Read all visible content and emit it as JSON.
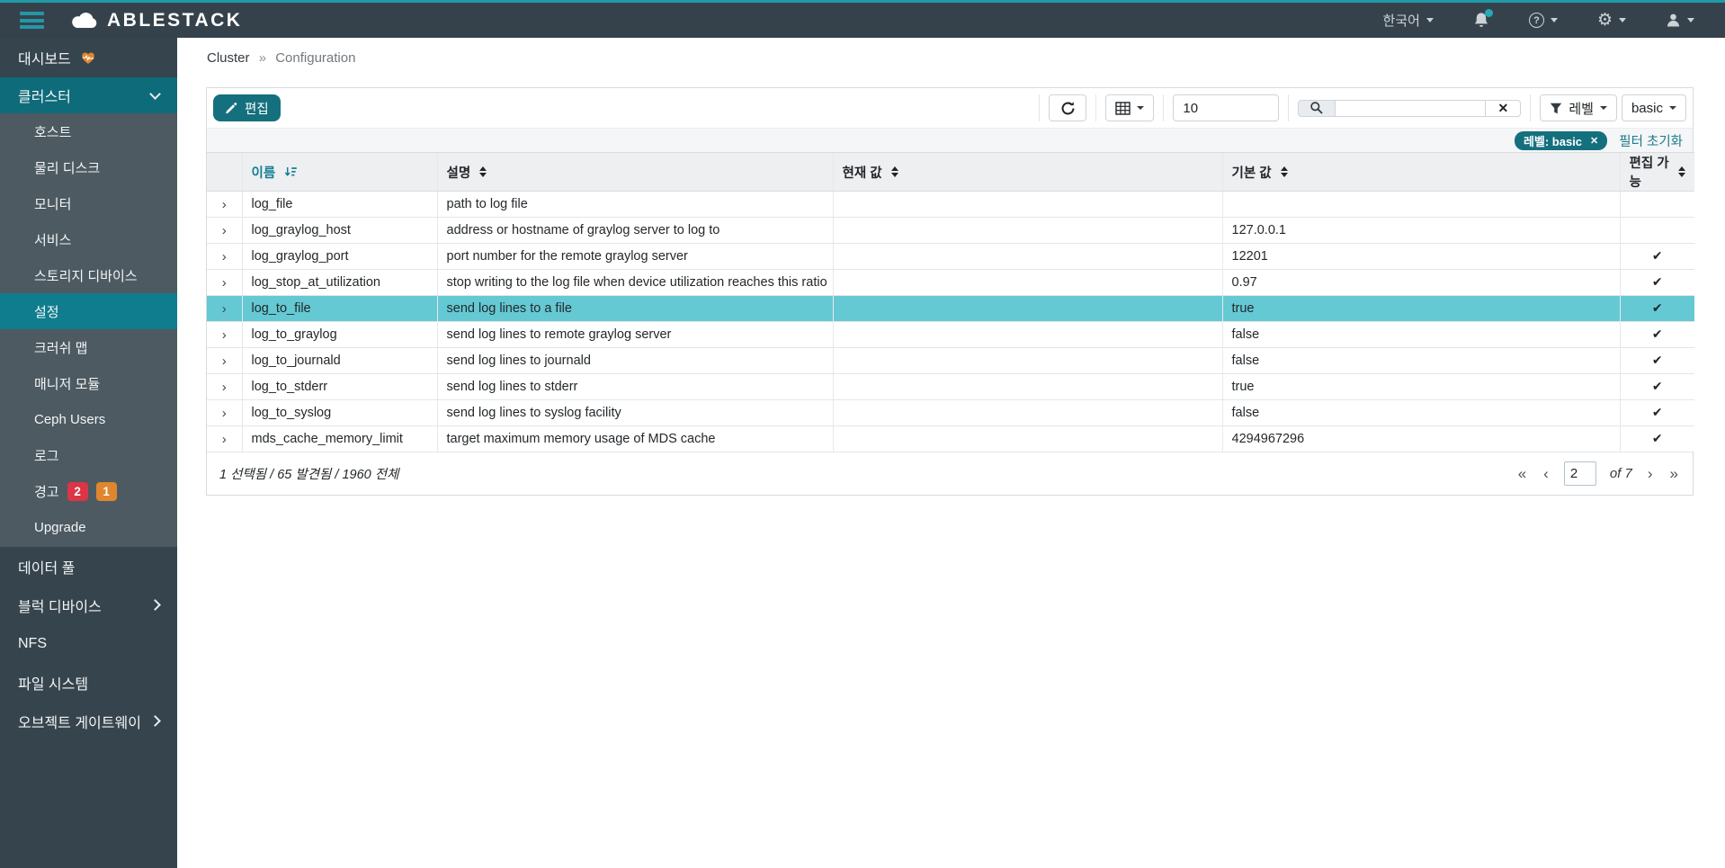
{
  "colors": {
    "accent_teal": "#15707e",
    "topbar_bg": "#36424b",
    "top_strip": "#1f9aa9",
    "sidebar_bg": "#36444d",
    "submenu_bg": "#4d5a62",
    "active_item_bg": "#0f7d8d",
    "selected_row_bg": "#64c9d3",
    "badge_red": "#dc3545",
    "badge_orange": "#e0862f"
  },
  "icons": {
    "help_glyph": "?",
    "gear_glyph": "⚙",
    "clear_glyph": "✕",
    "chip_close_glyph": "✕",
    "expand_glyph": "›"
  },
  "topbar": {
    "brand": "ABLESTACK",
    "language": "한국어"
  },
  "sidebar": {
    "items": [
      {
        "label": "대시보드"
      },
      {
        "label": "클러스터"
      },
      {
        "label": "호스트"
      },
      {
        "label": "물리 디스크"
      },
      {
        "label": "모니터"
      },
      {
        "label": "서비스"
      },
      {
        "label": "스토리지 디바이스"
      },
      {
        "label": "설정"
      },
      {
        "label": "크러쉬 맵"
      },
      {
        "label": "매니저 모듈"
      },
      {
        "label": "Ceph Users"
      },
      {
        "label": "로그"
      },
      {
        "label": "경고",
        "badge_red": "2",
        "badge_orange": "1"
      },
      {
        "label": "Upgrade"
      },
      {
        "label": "데이터 풀"
      },
      {
        "label": "블럭 디바이스"
      },
      {
        "label": "NFS"
      },
      {
        "label": "파일 시스템"
      },
      {
        "label": "오브젝트 게이트웨이"
      }
    ]
  },
  "breadcrumb": {
    "parent": "Cluster",
    "separator": "»",
    "current": "Configuration"
  },
  "toolbar": {
    "edit_label": "편집",
    "page_size": "10",
    "search_value": "",
    "level_label": "레벨",
    "level_value": "basic"
  },
  "filters": {
    "chip_label": "레벨: basic",
    "clear_label": "필터 초기화"
  },
  "table": {
    "headers": {
      "name": "이름",
      "description": "설명",
      "current": "현재 값",
      "default": "기본 값",
      "editable": "편집 가능"
    },
    "rows": [
      {
        "name": "log_file",
        "description": "path to log file",
        "current": "",
        "default": "",
        "editable": ""
      },
      {
        "name": "log_graylog_host",
        "description": "address or hostname of graylog server to log to",
        "current": "",
        "default": "127.0.0.1",
        "editable": ""
      },
      {
        "name": "log_graylog_port",
        "description": "port number for the remote graylog server",
        "current": "",
        "default": "12201",
        "editable": "✔"
      },
      {
        "name": "log_stop_at_utilization",
        "description": "stop writing to the log file when device utilization reaches this ratio",
        "current": "",
        "default": "0.97",
        "editable": "✔"
      },
      {
        "name": "log_to_file",
        "description": "send log lines to a file",
        "current": "",
        "default": "true",
        "editable": "✔",
        "selected": true
      },
      {
        "name": "log_to_graylog",
        "description": "send log lines to remote graylog server",
        "current": "",
        "default": "false",
        "editable": "✔"
      },
      {
        "name": "log_to_journald",
        "description": "send log lines to journald",
        "current": "",
        "default": "false",
        "editable": "✔"
      },
      {
        "name": "log_to_stderr",
        "description": "send log lines to stderr",
        "current": "",
        "default": "true",
        "editable": "✔"
      },
      {
        "name": "log_to_syslog",
        "description": "send log lines to syslog facility",
        "current": "",
        "default": "false",
        "editable": "✔"
      },
      {
        "name": "mds_cache_memory_limit",
        "description": "target maximum memory usage of MDS cache",
        "current": "",
        "default": "4294967296",
        "editable": "✔"
      }
    ]
  },
  "footer": {
    "summary": "1 선택됨 / 65 발견됨 / 1960 전체",
    "pagination": {
      "first": "«",
      "prev": "‹",
      "page": "2",
      "of": "of 7",
      "next": "›",
      "last": "»"
    }
  }
}
